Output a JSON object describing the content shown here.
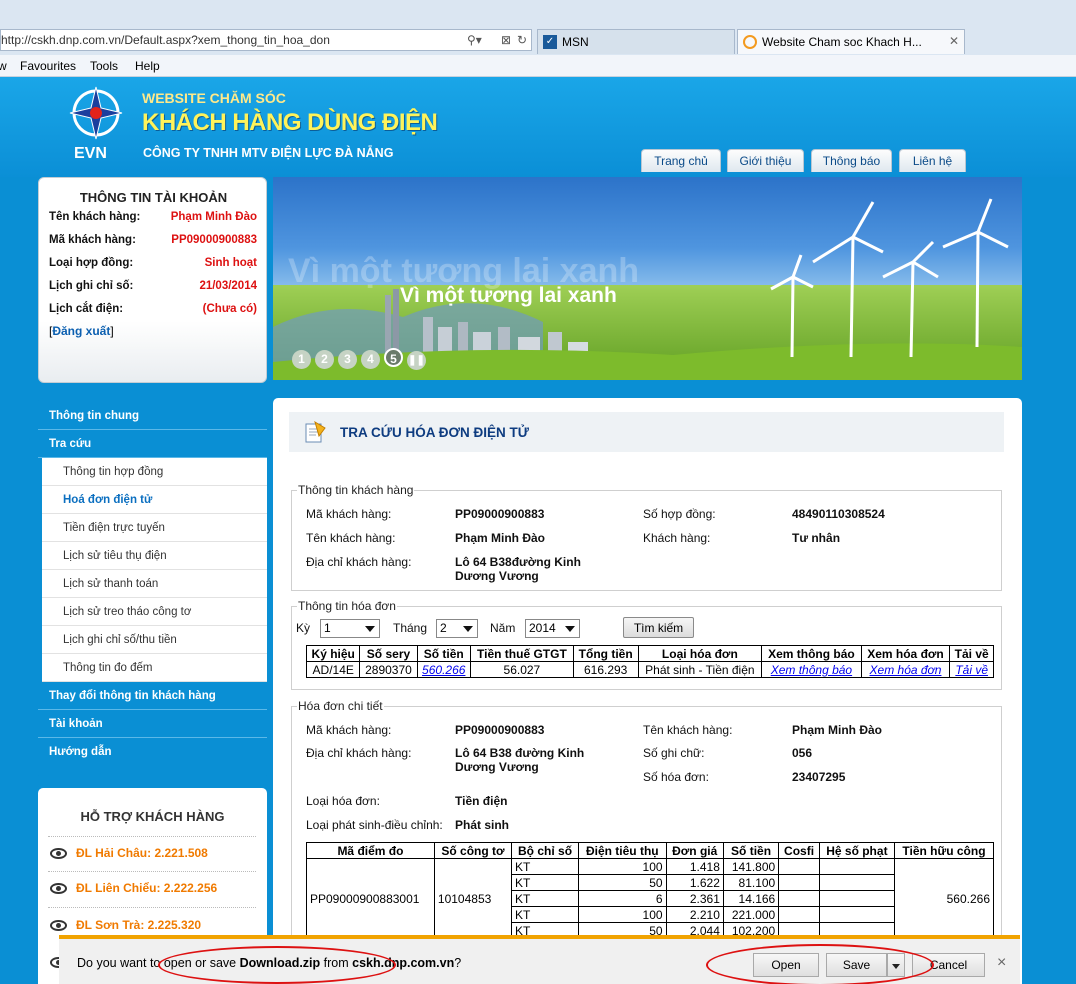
{
  "browser": {
    "address": "http://cskh.dnp.com.vn/Default.aspx?xem_thong_tin_hoa_don",
    "tabs": [
      {
        "label": "MSN"
      },
      {
        "label": "Website Cham soc Khach H..."
      }
    ],
    "menu": [
      "w",
      "Favourites",
      "Tools",
      "Help"
    ]
  },
  "site": {
    "brand": "EVN",
    "line1": "WEBSITE CHĂM SÓC",
    "line2": "KHÁCH HÀNG DÙNG ĐIỆN",
    "line3": "CÔNG TY TNHH MTV ĐIỆN LỰC ĐÀ NẴNG",
    "nav": [
      "Trang chủ",
      "Giới thiệu",
      "Thông báo",
      "Liên hệ"
    ]
  },
  "account": {
    "title": "THÔNG TIN TÀI KHOẢN",
    "rows": [
      {
        "label": "Tên khách hàng:",
        "value": "Phạm Minh Đào"
      },
      {
        "label": "Mã khách hàng:",
        "value": "PP09000900883"
      },
      {
        "label": "Loại hợp đồng:",
        "value": "Sinh hoạt"
      },
      {
        "label": "Lịch ghi chỉ số:",
        "value": "21/03/2014"
      },
      {
        "label": "Lịch cắt điện:",
        "value": "(Chưa có)"
      }
    ],
    "logout": "Đăng xuất"
  },
  "banner": {
    "slogan": "Vì một tương lai xanh",
    "slides": [
      "1",
      "2",
      "3",
      "4",
      "5"
    ]
  },
  "sidemenu": [
    {
      "label": "Thông tin chung",
      "type": "top"
    },
    {
      "label": "Tra cứu",
      "type": "top"
    },
    {
      "label": "Thông tin hợp đồng",
      "type": "sub"
    },
    {
      "label": "Hoá đơn điện tử",
      "type": "sub-active"
    },
    {
      "label": "Tiền điện trực tuyến",
      "type": "sub"
    },
    {
      "label": "Lịch sử tiêu thụ điện",
      "type": "sub"
    },
    {
      "label": "Lịch sử thanh toán",
      "type": "sub"
    },
    {
      "label": "Lịch sử treo tháo công tơ",
      "type": "sub"
    },
    {
      "label": "Lịch ghi chỉ số/thu tiền",
      "type": "sub"
    },
    {
      "label": "Thông tin đo đếm",
      "type": "sub"
    },
    {
      "label": "Thay đổi thông tin khách hàng",
      "type": "top"
    },
    {
      "label": "Tài khoản",
      "type": "top"
    },
    {
      "label": "Hướng dẫn",
      "type": "top"
    }
  ],
  "support": {
    "title": "HỖ TRỢ KHÁCH HÀNG",
    "items": [
      "ĐL Hải Châu: 2.221.508",
      "ĐL Liên Chiểu: 2.222.256",
      "ĐL Sơn Trà: 2.225.320"
    ]
  },
  "page": {
    "title": "TRA CỨU HÓA ĐƠN ĐIỆN TỬ",
    "customer": {
      "legend": "Thông tin khách hàng",
      "ma_kh_label": "Mã khách hàng:",
      "ma_kh": "PP09000900883",
      "so_hd_label": "Số hợp đồng:",
      "so_hd": "48490110308524",
      "ten_kh_label": "Tên khách hàng:",
      "ten_kh": "Phạm Minh Đào",
      "loai_kh_label": "Khách hàng:",
      "loai_kh": "Tư nhân",
      "dia_chi_label": "Địa chỉ khách hàng:",
      "dia_chi_1": "Lô 64 B38đường Kinh",
      "dia_chi_2": "Dương Vương"
    },
    "invoice": {
      "legend": "Thông tin hóa đơn",
      "ky_label": "Kỳ",
      "ky": "1",
      "thang_label": "Tháng",
      "thang": "2",
      "nam_label": "Năm",
      "nam": "2014",
      "search": "Tìm kiếm",
      "headers": [
        "Ký hiệu",
        "Số sery",
        "Số tiền",
        "Tiền thuế GTGT",
        "Tổng tiền",
        "Loại hóa đơn",
        "Xem thông báo",
        "Xem hóa đơn",
        "Tải về"
      ],
      "row": [
        "AD/14E",
        "2890370",
        "560.266",
        "56.027",
        "616.293",
        "Phát sinh - Tiền điện",
        "Xem thông báo",
        "Xem hóa đơn",
        "Tải về"
      ]
    },
    "detail": {
      "legend": "Hóa đơn chi tiết",
      "ma_kh_label": "Mã khách hàng:",
      "ma_kh": "PP09000900883",
      "ten_kh_label": "Tên khách hàng:",
      "ten_kh": "Phạm Minh Đào",
      "dia_chi_label": "Địa chỉ khách hàng:",
      "dia_chi_1": "Lô 64 B38 đường Kinh",
      "dia_chi_2": "Dương Vương",
      "so_ghi_chu_label": "Số ghi chữ:",
      "so_ghi_chu": "056",
      "so_hoa_don_label": "Số hóa đơn:",
      "so_hoa_don": "23407295",
      "loai_hd_label": "Loại hóa đơn:",
      "loai_hd": "Tiền điện",
      "loai_ps_label": "Loại phát sinh-điều chỉnh:",
      "loai_ps": "Phát sinh",
      "headers": [
        "Mã điểm đo",
        "Số công tơ",
        "Bộ chỉ số",
        "Điện tiêu thụ",
        "Đơn giá",
        "Số tiền",
        "Cosfi",
        "Hệ số phạt",
        "Tiền hữu công"
      ],
      "ma_diem_do": "PP09000900883001",
      "so_cong_to": "10104853",
      "tien_huu_cong": "560.266",
      "rows": [
        {
          "bcs": "KT",
          "dien": "100",
          "don_gia": "1.418",
          "so_tien": "141.800"
        },
        {
          "bcs": "KT",
          "dien": "50",
          "don_gia": "1.622",
          "so_tien": "81.100"
        },
        {
          "bcs": "KT",
          "dien": "6",
          "don_gia": "2.361",
          "so_tien": "14.166"
        },
        {
          "bcs": "KT",
          "dien": "100",
          "don_gia": "2.210",
          "so_tien": "221.000"
        },
        {
          "bcs": "KT",
          "dien": "50",
          "don_gia": "2.044",
          "so_tien": "102.200"
        }
      ]
    }
  },
  "download": {
    "msg_pre": "Do you want to open or save ",
    "file": "Download.zip",
    "msg_mid": " from ",
    "host": "cskh.dnp.com.vn",
    "msg_post": "?",
    "open": "Open",
    "save": "Save",
    "cancel": "Cancel",
    "close": "×"
  },
  "colors": {
    "accent": "#0a8fd4",
    "highlight": "#d11111",
    "download_bar": "#f1a300"
  }
}
